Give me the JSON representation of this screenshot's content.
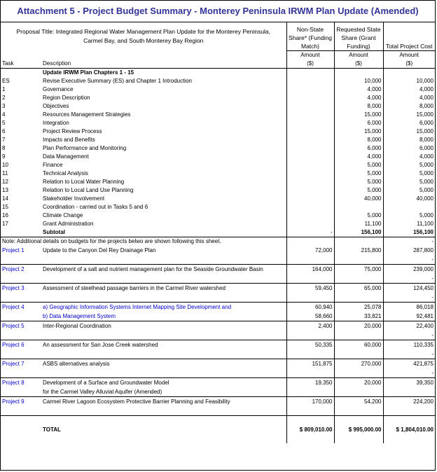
{
  "title": "Attachment 5 - Project Budget Summary - Monterey Peninsula IRWM Plan Update (Amended)",
  "header": {
    "proposal_title": "Proposal Title: Integrated Regional Water Management Plan Update for the Monterey Peninsula, Carmel Bay, and South Monterey Bay Region",
    "col3_title": "Non-State Share* (Funding Match)",
    "col4_title": "Requested State Share (Grant Funding)",
    "col5_title": "Total Project Cost",
    "task_label": "Task",
    "desc_label": "Description",
    "amount_label": "Amount",
    "unit_label": "($)"
  },
  "section_title": "Update IRWM Plan Chapters 1 - 15",
  "tasks": [
    {
      "task": "ES",
      "desc": "Revise Executive Summary (ES) and Chapter 1 Introduction",
      "state": "10,000",
      "total": "10,000"
    },
    {
      "task": "1",
      "desc": "Governance",
      "state": "4,000",
      "total": "4,000"
    },
    {
      "task": "2",
      "desc": "Region Description",
      "state": "4,000",
      "total": "4,000"
    },
    {
      "task": "3",
      "desc": "Objectives",
      "state": "8,000",
      "total": "8,000"
    },
    {
      "task": "4",
      "desc": "Resources Management Strategies",
      "state": "15,000",
      "total": "15,000"
    },
    {
      "task": "5",
      "desc": "Integration",
      "state": "6,000",
      "total": "6,000"
    },
    {
      "task": "6",
      "desc": "Project Review Process",
      "state": "15,000",
      "total": "15,000"
    },
    {
      "task": "7",
      "desc": "Impacts and Benefits",
      "state": "8,000",
      "total": "8,000"
    },
    {
      "task": "8",
      "desc": "Plan Performance and Monitoring",
      "state": "6,000",
      "total": "6,000"
    },
    {
      "task": "9",
      "desc": "Data Management",
      "state": "4,000",
      "total": "4,000"
    },
    {
      "task": "10",
      "desc": "Finance",
      "state": "5,000",
      "total": "5,000"
    },
    {
      "task": "11",
      "desc": "Technical Analysis",
      "state": "5,000",
      "total": "5,000"
    },
    {
      "task": "12",
      "desc": "Relation to Local Water Planning",
      "state": "5,000",
      "total": "5,000"
    },
    {
      "task": "13",
      "desc": "Relation to Local Land Use Planning",
      "state": "5,000",
      "total": "5,000"
    },
    {
      "task": "14",
      "desc": "Stakeholder Involvement",
      "state": "40,000",
      "total": "40,000"
    },
    {
      "task": "15",
      "desc": "Coordination - carried out in Tasks 5 and 6",
      "state": "",
      "total": ""
    },
    {
      "task": "16",
      "desc": "Climate Change",
      "state": "5,000",
      "total": "5,000"
    },
    {
      "task": "17",
      "desc": "Grant Administration",
      "state": "11,100",
      "total": "11,100"
    }
  ],
  "subtotal": {
    "label": "Subtotal",
    "match": "-",
    "state": "156,100",
    "total": "156,100"
  },
  "note": "Note: Additional details on budgets for the projects belwo are shown following this sheet.",
  "dash": "-",
  "projects": [
    {
      "task": "Project 1",
      "desc": "Update to the Canyon Del Rey Drainage Plan",
      "match": "72,000",
      "state": "215,800",
      "total": "287,800"
    },
    {
      "task": "Project 2",
      "desc": "Development of a salt and nutrient management plan for the Seaside Groundwater Basin",
      "match": "164,000",
      "state": "75,000",
      "total": "239,000"
    },
    {
      "task": "Project 3",
      "desc": "Assessment of steelhead passage barriers in the Carmel River watershed",
      "match": "59,450",
      "state": "65,000",
      "total": "124,450"
    },
    {
      "task": "Project 4",
      "desc": "a) Geographic Information Systems Internet Mapping Site Development and",
      "match": "60,940",
      "state": "25,078",
      "total": "86,018",
      "desc2": "b) Data Management System",
      "match2": "58,660",
      "state2": "33,821",
      "total2": "92,481"
    },
    {
      "task": "Project 5",
      "desc": "Inter-Regional Coordination",
      "match": "2,400",
      "state": "20,000",
      "total": "22,400"
    },
    {
      "task": "Project 6",
      "desc": "An assessment for San Jose Creek watershed",
      "match": "50,335",
      "state": "60,000",
      "total": "110,335"
    },
    {
      "task": "Project 7",
      "desc": "ASBS alternatives analysis",
      "match": "151,875",
      "state": "270,000",
      "total": "421,875"
    },
    {
      "task": "Project 8",
      "desc": "Development of a Surface and Groundwater Model",
      "desc2": "for the Carmel Valley Alluvial Aquifer (Amended)",
      "match": "19,350",
      "state": "20,000",
      "total": "39,350"
    },
    {
      "task": "Project 9",
      "desc": "Carmel River Lagoon Ecosystem Protective Barrier Planning and Feasibility",
      "match": "170,000",
      "state": "54,200",
      "total": "224,200"
    }
  ],
  "total": {
    "label": "TOTAL",
    "match": "$  809,010.00",
    "state": "$  995,000.00",
    "total": "$  1,804,010.00"
  },
  "colors": {
    "title": "#333399",
    "project_link": "#0000cc"
  }
}
